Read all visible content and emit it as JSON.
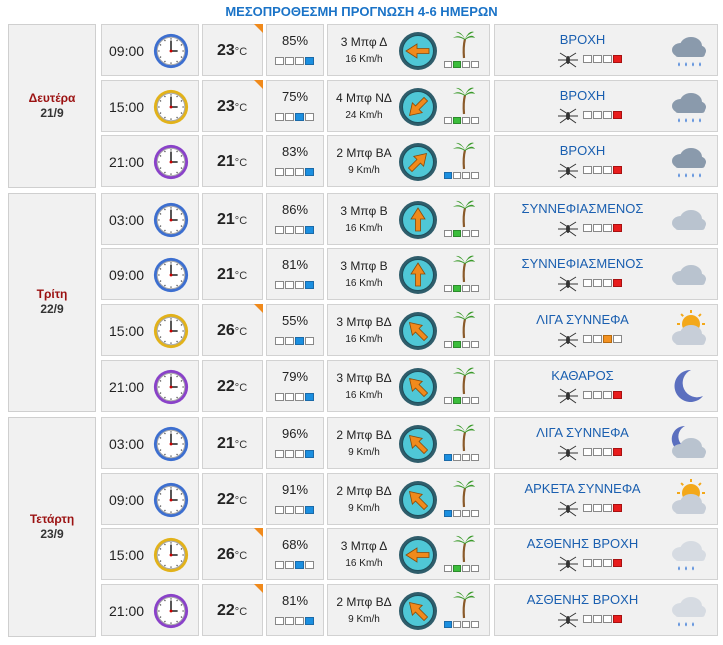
{
  "title": "ΜΕΣΟΠΡΟΘΕΣΜΗ ΠΡΟΓΝΩΣΗ 4-6 ΗΜΕΡΩΝ",
  "temp_unit": "°C",
  "colors": {
    "title": "#1a73c7",
    "day_name": "#9b1111",
    "condition": "#1a5fb0",
    "flag": "#f08a1c"
  },
  "days": [
    {
      "name": "Δευτέρα",
      "date": "21/9",
      "rows": [
        {
          "time": "09:00",
          "clock": "blue",
          "temp": "23",
          "flag": true,
          "humidity": "85%",
          "hum_level": 4,
          "wind": "3 Μπφ Δ",
          "speed": "16 Km/h",
          "wind_dir": "W",
          "wind_level": 2,
          "wind_color": "g",
          "condition": "ΒΡΟΧΗ",
          "cond_level": 4,
          "cond_color": "r",
          "icon": "rain-icon"
        },
        {
          "time": "15:00",
          "clock": "yellow",
          "temp": "23",
          "flag": true,
          "humidity": "75%",
          "hum_level": 3,
          "wind": "4 Μπφ ΝΔ",
          "speed": "24 Km/h",
          "wind_dir": "SW",
          "wind_level": 2,
          "wind_color": "g",
          "condition": "ΒΡΟΧΗ",
          "cond_level": 4,
          "cond_color": "r",
          "icon": "rain-icon"
        },
        {
          "time": "21:00",
          "clock": "purple",
          "temp": "21",
          "flag": false,
          "humidity": "83%",
          "hum_level": 4,
          "wind": "2 Μπφ ΒΑ",
          "speed": "9 Km/h",
          "wind_dir": "NE",
          "wind_level": 1,
          "wind_color": "b",
          "condition": "ΒΡΟΧΗ",
          "cond_level": 4,
          "cond_color": "r",
          "icon": "rain-icon"
        }
      ]
    },
    {
      "name": "Τρίτη",
      "date": "22/9",
      "rows": [
        {
          "time": "03:00",
          "clock": "blue",
          "temp": "21",
          "flag": false,
          "humidity": "86%",
          "hum_level": 4,
          "wind": "3 Μπφ Β",
          "speed": "16 Km/h",
          "wind_dir": "N",
          "wind_level": 2,
          "wind_color": "g",
          "condition": "ΣΥΝΝΕΦΙΑΣΜΕΝΟΣ",
          "cond_level": 4,
          "cond_color": "r",
          "icon": "cloud-icon"
        },
        {
          "time": "09:00",
          "clock": "blue",
          "temp": "21",
          "flag": false,
          "humidity": "81%",
          "hum_level": 4,
          "wind": "3 Μπφ Β",
          "speed": "16 Km/h",
          "wind_dir": "N",
          "wind_level": 2,
          "wind_color": "g",
          "condition": "ΣΥΝΝΕΦΙΑΣΜΕΝΟΣ",
          "cond_level": 4,
          "cond_color": "r",
          "icon": "cloud-icon"
        },
        {
          "time": "15:00",
          "clock": "yellow",
          "temp": "26",
          "flag": true,
          "humidity": "55%",
          "hum_level": 3,
          "wind": "3 Μπφ ΒΔ",
          "speed": "16 Km/h",
          "wind_dir": "NW",
          "wind_level": 2,
          "wind_color": "g",
          "condition": "ΛΙΓΑ ΣΥΝΝΕΦΑ",
          "cond_level": 3,
          "cond_color": "o",
          "icon": "sun-cloud-icon"
        },
        {
          "time": "21:00",
          "clock": "purple",
          "temp": "22",
          "flag": false,
          "humidity": "79%",
          "hum_level": 4,
          "wind": "3 Μπφ ΒΔ",
          "speed": "16 Km/h",
          "wind_dir": "NW",
          "wind_level": 2,
          "wind_color": "g",
          "condition": "ΚΑΘΑΡΟΣ",
          "cond_level": 4,
          "cond_color": "r",
          "icon": "moon-icon"
        }
      ]
    },
    {
      "name": "Τετάρτη",
      "date": "23/9",
      "rows": [
        {
          "time": "03:00",
          "clock": "blue",
          "temp": "21",
          "flag": false,
          "humidity": "96%",
          "hum_level": 4,
          "wind": "2 Μπφ ΒΔ",
          "speed": "9 Km/h",
          "wind_dir": "NW",
          "wind_level": 1,
          "wind_color": "b",
          "condition": "ΛΙΓΑ ΣΥΝΝΕΦΑ",
          "cond_level": 4,
          "cond_color": "r",
          "icon": "moon-cloud-icon"
        },
        {
          "time": "09:00",
          "clock": "blue",
          "temp": "22",
          "flag": false,
          "humidity": "91%",
          "hum_level": 4,
          "wind": "2 Μπφ ΒΔ",
          "speed": "9 Km/h",
          "wind_dir": "NW",
          "wind_level": 1,
          "wind_color": "b",
          "condition": "ΑΡΚΕΤΑ ΣΥΝΝΕΦΑ",
          "cond_level": 4,
          "cond_color": "r",
          "icon": "sun-cloud-icon"
        },
        {
          "time": "15:00",
          "clock": "yellow",
          "temp": "26",
          "flag": true,
          "humidity": "68%",
          "hum_level": 3,
          "wind": "3 Μπφ Δ",
          "speed": "16 Km/h",
          "wind_dir": "W",
          "wind_level": 2,
          "wind_color": "g",
          "condition": "ΑΣΘΕΝΗΣ ΒΡΟΧΗ",
          "cond_level": 4,
          "cond_color": "r",
          "icon": "light-rain-icon"
        },
        {
          "time": "21:00",
          "clock": "purple",
          "temp": "22",
          "flag": true,
          "humidity": "81%",
          "hum_level": 4,
          "wind": "2 Μπφ ΒΔ",
          "speed": "9 Km/h",
          "wind_dir": "NW",
          "wind_level": 1,
          "wind_color": "b",
          "condition": "ΑΣΘΕΝΗΣ ΒΡΟΧΗ",
          "cond_level": 4,
          "cond_color": "r",
          "icon": "light-rain-icon"
        }
      ]
    }
  ]
}
